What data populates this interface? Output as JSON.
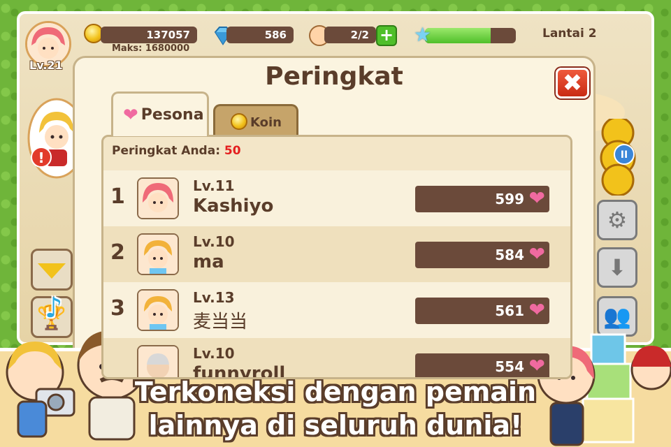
{
  "hud": {
    "coins": "137057",
    "coins_max": "Maks: 1680000",
    "gems": "586",
    "workers": "2/2",
    "plus_label": "+",
    "xp_fraction": 0.72,
    "floor_label": "Lantai 2",
    "player_level": "Lv.21"
  },
  "side": {
    "alert_label": "!",
    "pause_label": "II"
  },
  "modal": {
    "title": "Peringkat",
    "close_label": "✖",
    "tabs": [
      {
        "label": "Pesona",
        "icon": "heart-icon",
        "active": true
      },
      {
        "label": "Koin",
        "icon": "coin-icon",
        "active": false
      }
    ],
    "your_rank_label": "Peringkat Anda:",
    "your_rank_value": "50",
    "rows": [
      {
        "rank": "1",
        "level": "Lv.11",
        "name": "Kashiyo",
        "score": "599",
        "avatar": "red-hair-girl"
      },
      {
        "rank": "2",
        "level": "Lv.10",
        "name": "ma",
        "score": "584",
        "avatar": "blond-boy"
      },
      {
        "rank": "3",
        "level": "Lv.13",
        "name": "麦当当",
        "score": "561",
        "avatar": "blond-boy"
      },
      {
        "rank": "",
        "level": "Lv.10",
        "name": "funnyroll",
        "score": "554",
        "avatar": "old-man"
      }
    ]
  },
  "banner": {
    "line1": "Terkoneksi dengan pemain",
    "line2": "lainnya di seluruh dunia!"
  },
  "colors": {
    "brown": "#5a3d2a",
    "bar": "#6b4a3a",
    "heart": "#f06aa0",
    "accent_red": "#e41e1e"
  }
}
